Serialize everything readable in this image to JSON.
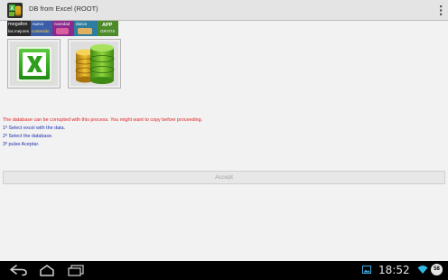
{
  "window": {
    "title": "DB from Excel (ROOT)"
  },
  "icons": {
    "app": "db-excel-app-icon",
    "overflow": "overflow-menu-icon",
    "excel": "excel-icon",
    "database": "database-icon",
    "back": "back-icon",
    "home": "home-icon",
    "recents": "recent-apps-icon",
    "gallery": "image-notification-icon",
    "wifi": "wifi-icon",
    "battery": "battery-icon"
  },
  "ad_banner": {
    "tiles": [
      {
        "label": "megafon",
        "sublabel": "los mejores"
      },
      {
        "label": "nuevo",
        "sublabel": "contenido"
      },
      {
        "label": "novedad",
        "sublabel": ""
      },
      {
        "label": "dance",
        "sublabel": ""
      },
      {
        "label": "APP",
        "sublabel": "GRATIS"
      }
    ]
  },
  "messages": {
    "warning": "The database can be corrupted with this process. You might want to copy before proceeding.",
    "step1": "1º Select excel with the data.",
    "step2": "2º Select the database.",
    "step3": "3º pulse Aceptar."
  },
  "buttons": {
    "accept": "Accept"
  },
  "status_bar": {
    "time": "18:52",
    "badge": "58"
  },
  "colors": {
    "warning": "#e02020",
    "steps": "#1f2fb0",
    "excel_green": "#2e9e1c",
    "db_gold": "#d8a41c",
    "db_green": "#6cb527"
  }
}
